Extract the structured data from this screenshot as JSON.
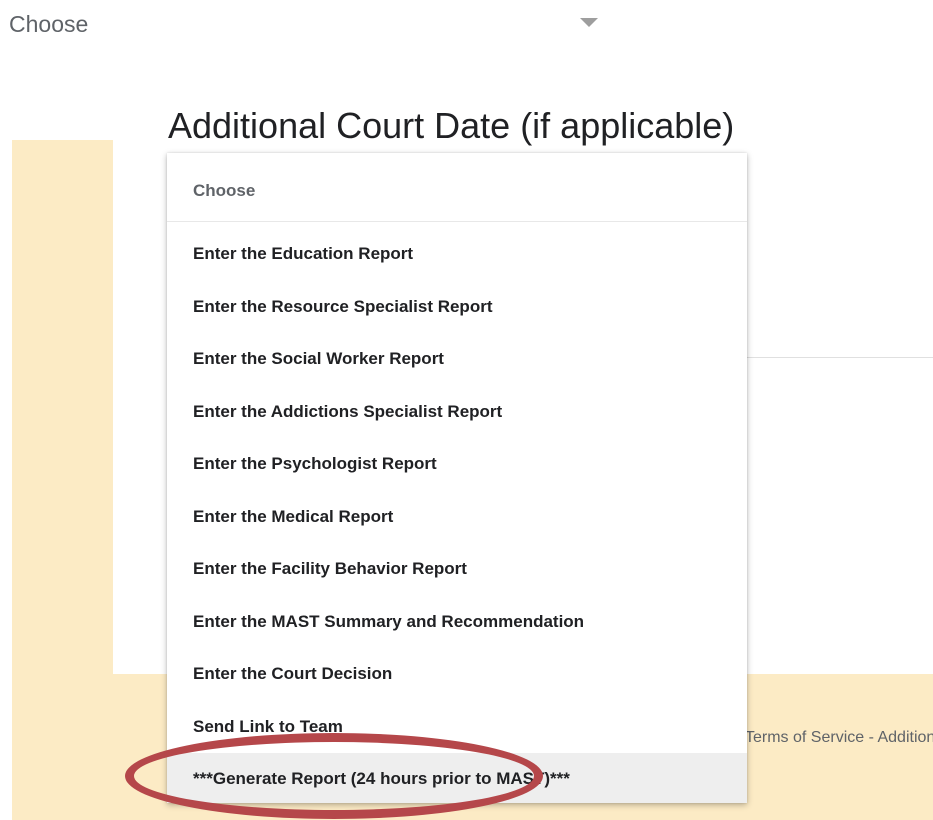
{
  "top_select": {
    "value": "Choose"
  },
  "question": {
    "title": "Additional Court Date (if applicable)"
  },
  "menu": {
    "header": "Choose",
    "items": [
      {
        "label": "Enter the Education Report"
      },
      {
        "label": "Enter the Resource Specialist Report"
      },
      {
        "label": "Enter the Social Worker Report"
      },
      {
        "label": "Enter the Addictions Specialist Report"
      },
      {
        "label": "Enter the Psychologist Report"
      },
      {
        "label": "Enter the Medical Report"
      },
      {
        "label": "Enter the Facility Behavior Report"
      },
      {
        "label": "Enter the MAST Summary and Recommendation"
      },
      {
        "label": "Enter the Court Decision"
      },
      {
        "label": "Send Link to Team"
      },
      {
        "label": "***Generate Report (24 hours prior to MAST)***"
      }
    ],
    "highlighted_index": 10
  },
  "footer": {
    "text": "Terms of Service - Additional Terms"
  },
  "colors": {
    "page_background": "#fcebc5",
    "annotation": "#b5474a",
    "highlight": "#eeeeee"
  }
}
